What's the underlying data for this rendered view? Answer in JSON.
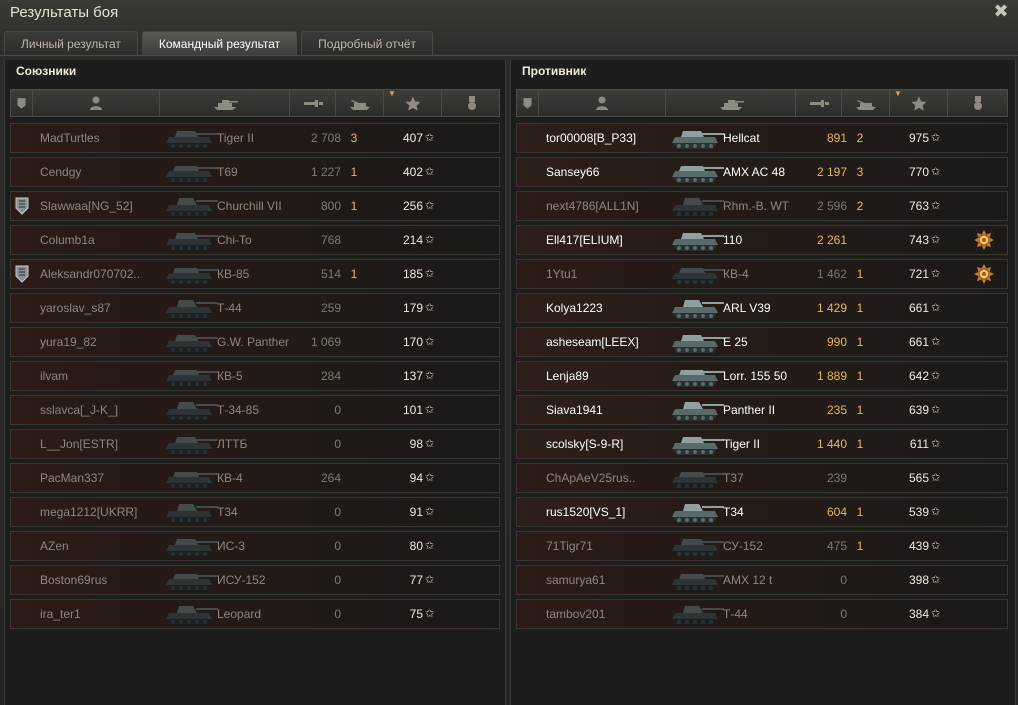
{
  "window": {
    "title": "Результаты боя"
  },
  "tabs": [
    {
      "label": "Личный результат",
      "active": false
    },
    {
      "label": "Командный результат",
      "active": true
    },
    {
      "label": "Подробный отчёт",
      "active": false
    }
  ],
  "allies": {
    "title": "Союзники",
    "rows": [
      {
        "name": "MadTurtles",
        "tank": "Tiger II",
        "damage": "2 708",
        "kills": "3",
        "xp": "407",
        "alive": false,
        "me": true,
        "badge": false,
        "medal": false
      },
      {
        "name": "Cendgy",
        "tank": "T69",
        "damage": "1 227",
        "kills": "1",
        "xp": "402",
        "alive": false,
        "me": false,
        "badge": false,
        "medal": false
      },
      {
        "name": "Slawwaa[NG_52]",
        "tank": "Churchill VII",
        "damage": "800",
        "kills": "1",
        "xp": "256",
        "alive": false,
        "me": false,
        "badge": true,
        "medal": false
      },
      {
        "name": "Columb1a",
        "tank": "Chi-To",
        "damage": "768",
        "kills": "",
        "xp": "214",
        "alive": false,
        "me": false,
        "badge": false,
        "medal": false
      },
      {
        "name": "Aleksandr070702..",
        "tank": "КВ-85",
        "damage": "514",
        "kills": "1",
        "xp": "185",
        "alive": false,
        "me": false,
        "badge": true,
        "medal": false
      },
      {
        "name": "yaroslav_s87",
        "tank": "Т-44",
        "damage": "259",
        "kills": "",
        "xp": "179",
        "alive": false,
        "me": false,
        "badge": false,
        "medal": false
      },
      {
        "name": "yura19_82",
        "tank": "G.W. Panther",
        "damage": "1 069",
        "kills": "",
        "xp": "170",
        "alive": false,
        "me": false,
        "badge": false,
        "medal": false
      },
      {
        "name": "ilvam",
        "tank": "КВ-5",
        "damage": "284",
        "kills": "",
        "xp": "137",
        "alive": false,
        "me": false,
        "badge": false,
        "medal": false
      },
      {
        "name": "sslavca[_J-K_]",
        "tank": "Т-34-85",
        "damage": "0",
        "kills": "",
        "xp": "101",
        "alive": false,
        "me": false,
        "badge": false,
        "medal": false
      },
      {
        "name": "L__Jon[ESTR]",
        "tank": "ЛТТБ",
        "damage": "0",
        "kills": "",
        "xp": "98",
        "alive": false,
        "me": false,
        "badge": false,
        "medal": false
      },
      {
        "name": "PacMan337",
        "tank": "КВ-4",
        "damage": "264",
        "kills": "",
        "xp": "94",
        "alive": false,
        "me": false,
        "badge": false,
        "medal": false
      },
      {
        "name": "mega1212[UKRR]",
        "tank": "Т34",
        "damage": "0",
        "kills": "",
        "xp": "91",
        "alive": false,
        "me": false,
        "badge": false,
        "medal": false
      },
      {
        "name": "AZen",
        "tank": "ИС-3",
        "damage": "0",
        "kills": "",
        "xp": "80",
        "alive": false,
        "me": false,
        "badge": false,
        "medal": false
      },
      {
        "name": "Boston69rus",
        "tank": "ИСУ-152",
        "damage": "0",
        "kills": "",
        "xp": "77",
        "alive": false,
        "me": false,
        "badge": false,
        "medal": false
      },
      {
        "name": "ira_ter1",
        "tank": "Leopard",
        "damage": "0",
        "kills": "",
        "xp": "75",
        "alive": false,
        "me": false,
        "badge": false,
        "medal": false
      }
    ]
  },
  "enemies": {
    "title": "Противник",
    "rows": [
      {
        "name": "tor00008[B_P33]",
        "tank": "Hellcat",
        "damage": "891",
        "kills": "2",
        "xp": "975",
        "alive": true,
        "badge": false,
        "medal": false
      },
      {
        "name": "Sansey66",
        "tank": "AMX AC 48",
        "damage": "2 197",
        "kills": "3",
        "xp": "770",
        "alive": true,
        "badge": false,
        "medal": false
      },
      {
        "name": "next4786[ALL1N]",
        "tank": "Rhm.-B. WT",
        "damage": "2 596",
        "kills": "2",
        "xp": "763",
        "alive": false,
        "badge": false,
        "medal": false
      },
      {
        "name": "Ell417[ELIUM]",
        "tank": "110",
        "damage": "2 261",
        "kills": "",
        "xp": "743",
        "alive": true,
        "badge": false,
        "medal": true
      },
      {
        "name": "1Ytu1",
        "tank": "КВ-4",
        "damage": "1 462",
        "kills": "1",
        "xp": "721",
        "alive": false,
        "badge": false,
        "medal": true
      },
      {
        "name": "Kolya1223",
        "tank": "ARL V39",
        "damage": "1 429",
        "kills": "1",
        "xp": "661",
        "alive": true,
        "badge": false,
        "medal": false
      },
      {
        "name": "asheseam[LEEX]",
        "tank": "E 25",
        "damage": "990",
        "kills": "1",
        "xp": "661",
        "alive": true,
        "badge": false,
        "medal": false
      },
      {
        "name": "Lenja89",
        "tank": "Lorr. 155 50",
        "damage": "1 889",
        "kills": "1",
        "xp": "642",
        "alive": true,
        "badge": false,
        "medal": false
      },
      {
        "name": "Siava1941",
        "tank": "Panther II",
        "damage": "235",
        "kills": "1",
        "xp": "639",
        "alive": true,
        "badge": false,
        "medal": false
      },
      {
        "name": "scolsky[S-9-R]",
        "tank": "Tiger II",
        "damage": "1 440",
        "kills": "1",
        "xp": "611",
        "alive": true,
        "badge": false,
        "medal": false
      },
      {
        "name": "ChApAeV25rus..",
        "tank": "T37",
        "damage": "239",
        "kills": "",
        "xp": "565",
        "alive": false,
        "badge": false,
        "medal": false
      },
      {
        "name": "rus1520[VS_1]",
        "tank": "Т34",
        "damage": "604",
        "kills": "1",
        "xp": "539",
        "alive": true,
        "badge": false,
        "medal": false
      },
      {
        "name": "71Tigr71",
        "tank": "СУ-152",
        "damage": "475",
        "kills": "1",
        "xp": "439",
        "alive": false,
        "badge": false,
        "medal": false
      },
      {
        "name": "samurya61",
        "tank": "AMX 12 t",
        "damage": "0",
        "kills": "",
        "xp": "398",
        "alive": false,
        "badge": false,
        "medal": false
      },
      {
        "name": "tambov201",
        "tank": "Т-44",
        "damage": "0",
        "kills": "",
        "xp": "384",
        "alive": false,
        "badge": false,
        "medal": false
      }
    ]
  },
  "icons": {
    "close": "close-icon",
    "columns": [
      "squad-icon",
      "player-icon",
      "vehicle-icon",
      "damage-icon",
      "kills-icon",
      "experience-star-icon",
      "medal-icon"
    ],
    "star_glyph": "✩",
    "close_glyph": "✖"
  },
  "colors": {
    "gold": "#e6b85c",
    "alive_text": "#ffffff",
    "dead_text": "#8f887a"
  }
}
